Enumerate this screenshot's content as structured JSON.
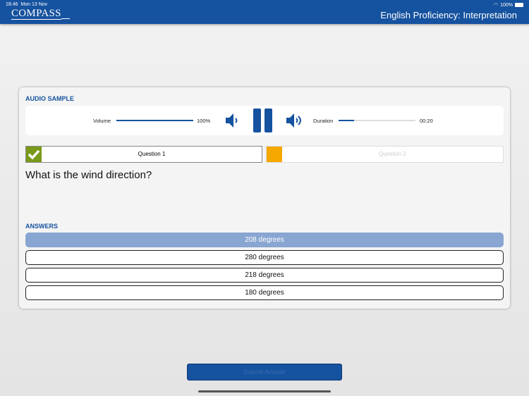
{
  "status": {
    "time": "18:46",
    "date": "Mon 13 Nov",
    "battery": "100%"
  },
  "header": {
    "logo": "COMPASS",
    "title": "English Proficiency: Interpretation"
  },
  "audio": {
    "label": "AUDIO SAMPLE",
    "volume_label": "Volume",
    "volume_value": "100%",
    "volume_fraction": 1.0,
    "duration_label": "Duration",
    "duration_value": "00:20",
    "progress_fraction": 0.2
  },
  "questions": [
    {
      "label": "Question 1",
      "status": "completed",
      "color": "#7a9a1a"
    },
    {
      "label": "Question 2",
      "status": "current",
      "color": "#f5a800"
    }
  ],
  "question_text": "What is the wind direction?",
  "answers_label": "ANSWERS",
  "answers": [
    {
      "label": "208 degrees",
      "selected": true
    },
    {
      "label": "280 degrees"
    },
    {
      "label": "218 degrees"
    },
    {
      "label": "180 degrees"
    }
  ],
  "submit_label": "Submit Answer",
  "colors": {
    "brand": "#15529f",
    "selected": "#89a6d2"
  }
}
